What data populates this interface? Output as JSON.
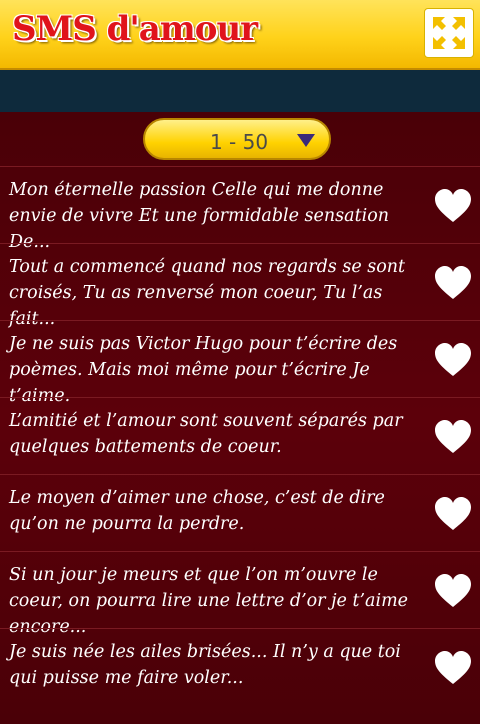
{
  "app": {
    "title": "SMS d'amour"
  },
  "toolbar": {
    "expand_icon": "expand-arrows-icon"
  },
  "pager": {
    "selected": "1 - 50"
  },
  "messages": [
    {
      "text": "Mon éternelle passion Celle qui me donne envie de vivre Et une formidable sensation De..."
    },
    {
      "text": "Tout a commencé quand nos regards se sont croisés, Tu as renversé mon coeur, Tu l’as fait..."
    },
    {
      "text": "Je ne suis pas Victor Hugo pour t’écrire des poèmes. Mais moi même pour t’écrire Je t’aime."
    },
    {
      "text": "L’amitié et l’amour sont souvent séparés par quelques battements de coeur."
    },
    {
      "text": "Le moyen d’aimer une chose, c’est de dire qu’on ne pourra la perdre."
    },
    {
      "text": "Si un jour je meurs et que l’on m’ouvre le coeur, on pourra lire une lettre d’or je t’aime encore..."
    },
    {
      "text": "Je suis née les ailes brisées... Il n’y a que toi qui puisse me faire voler..."
    }
  ],
  "colors": {
    "accent": "#ffd21a",
    "title_red": "#e0141b",
    "background": "#5a0008"
  }
}
